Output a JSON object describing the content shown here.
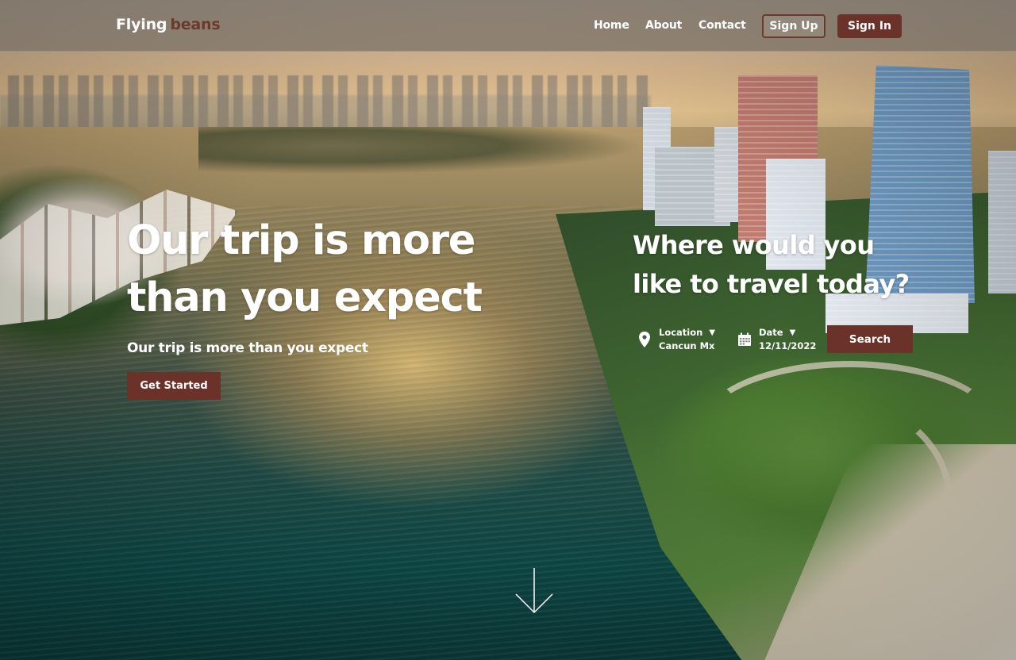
{
  "brand": {
    "word1": "Flying",
    "word2": "beans"
  },
  "nav": {
    "links": [
      "Home",
      "About",
      "Contact"
    ],
    "sign_up": "Sign Up",
    "sign_in": "Sign In"
  },
  "hero": {
    "title_line1": "Our trip is more",
    "title_line2": "than you expect",
    "subtitle": "Our trip is more than you expect",
    "cta": "Get Started"
  },
  "search": {
    "title_line1": "Where would you",
    "title_line2": "like to travel today?",
    "location_label": "Location",
    "location_value": "Cancun Mx",
    "date_label": "Date",
    "date_value": "12/11/2022",
    "caret": "▼",
    "button": "Search"
  },
  "icons": {
    "location": "map-pin-icon",
    "date": "calendar-icon",
    "scroll": "arrow-down-icon"
  },
  "colors": {
    "accent": "#6a3228",
    "navbar": "#78706680"
  }
}
